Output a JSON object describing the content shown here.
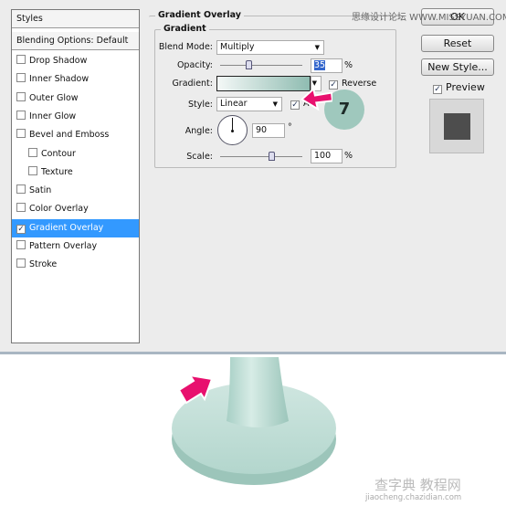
{
  "styles_panel": {
    "header": "Styles",
    "blending": "Blending Options: Default",
    "items": [
      {
        "label": "Drop Shadow",
        "checked": false,
        "indent": false
      },
      {
        "label": "Inner Shadow",
        "checked": false,
        "indent": false
      },
      {
        "label": "Outer Glow",
        "checked": false,
        "indent": false
      },
      {
        "label": "Inner Glow",
        "checked": false,
        "indent": false
      },
      {
        "label": "Bevel and Emboss",
        "checked": false,
        "indent": false
      },
      {
        "label": "Contour",
        "checked": false,
        "indent": true
      },
      {
        "label": "Texture",
        "checked": false,
        "indent": true
      },
      {
        "label": "Satin",
        "checked": false,
        "indent": false
      },
      {
        "label": "Color Overlay",
        "checked": false,
        "indent": false
      },
      {
        "label": "Gradient Overlay",
        "checked": true,
        "indent": false,
        "selected": true
      },
      {
        "label": "Pattern Overlay",
        "checked": false,
        "indent": false
      },
      {
        "label": "Stroke",
        "checked": false,
        "indent": false
      }
    ]
  },
  "gradient_overlay": {
    "title": "Gradient Overlay",
    "group": "Gradient",
    "blend_mode_label": "Blend Mode:",
    "blend_mode": "Multiply",
    "opacity_label": "Opacity:",
    "opacity": "35",
    "opacity_unit": "%",
    "gradient_label": "Gradient:",
    "gradient_colors": [
      "#f4f8f7",
      "#8fbcb1"
    ],
    "reverse_label": "Reverse",
    "reverse_checked": true,
    "style_label": "Style:",
    "style": "Linear",
    "align_checked": true,
    "align_label": "A",
    "angle_label": "Angle:",
    "angle": "90",
    "angle_unit": "°",
    "scale_label": "Scale:",
    "scale": "100",
    "scale_unit": "%"
  },
  "buttons": {
    "ok": "OK",
    "reset": "Reset",
    "new_style": "New Style...",
    "preview": "Preview",
    "preview_checked": true
  },
  "callout": {
    "step": "7",
    "badge_color": "#9fc8bd",
    "arrow_color": "#e8106e"
  },
  "watermarks": {
    "top": "思缘设计论坛 WWW.MISSYUAN.COM",
    "bottom_cn": "查字典 教程网",
    "bottom_url": "jiaocheng.chazidian.com"
  }
}
